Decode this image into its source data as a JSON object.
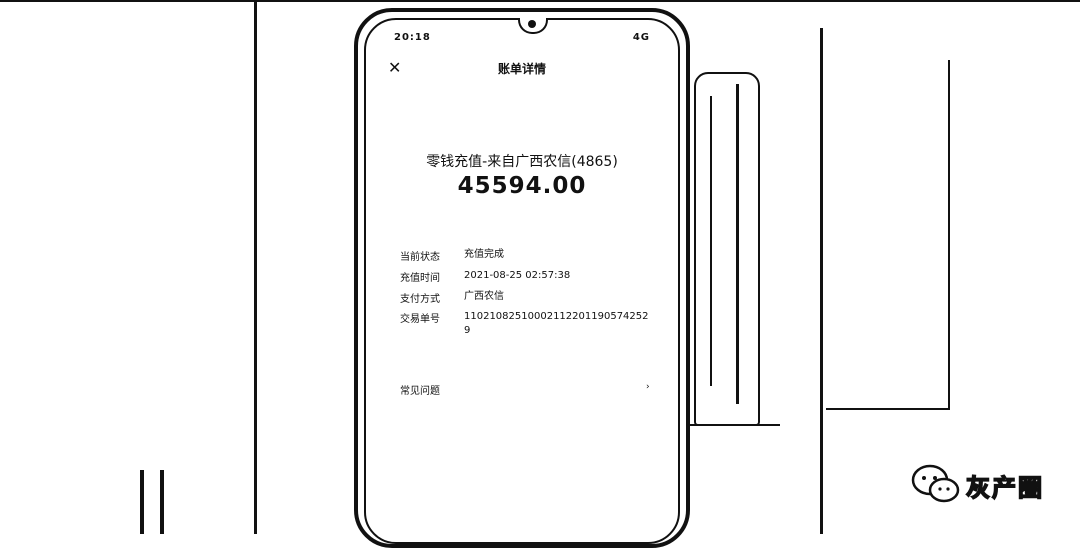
{
  "status_bar": {
    "time": "20:18",
    "right": "4G"
  },
  "header": {
    "close_icon": "close-icon",
    "title": "账单详情"
  },
  "summary": {
    "subtitle": "零钱充值-来自广西农信(4865)",
    "amount": "45594.00"
  },
  "details": [
    {
      "label": "当前状态",
      "value": "充值完成"
    },
    {
      "label": "充值时间",
      "value": "2021-08-25 02:57:38"
    },
    {
      "label": "支付方式",
      "value": "广西农信"
    },
    {
      "label": "交易单号",
      "value": "110210825100021122011905742529"
    }
  ],
  "faq": {
    "label": "常见问题",
    "icon": "chevron-right-icon"
  },
  "watermark": {
    "text": "灰产圈",
    "icon": "wechat-icon"
  }
}
